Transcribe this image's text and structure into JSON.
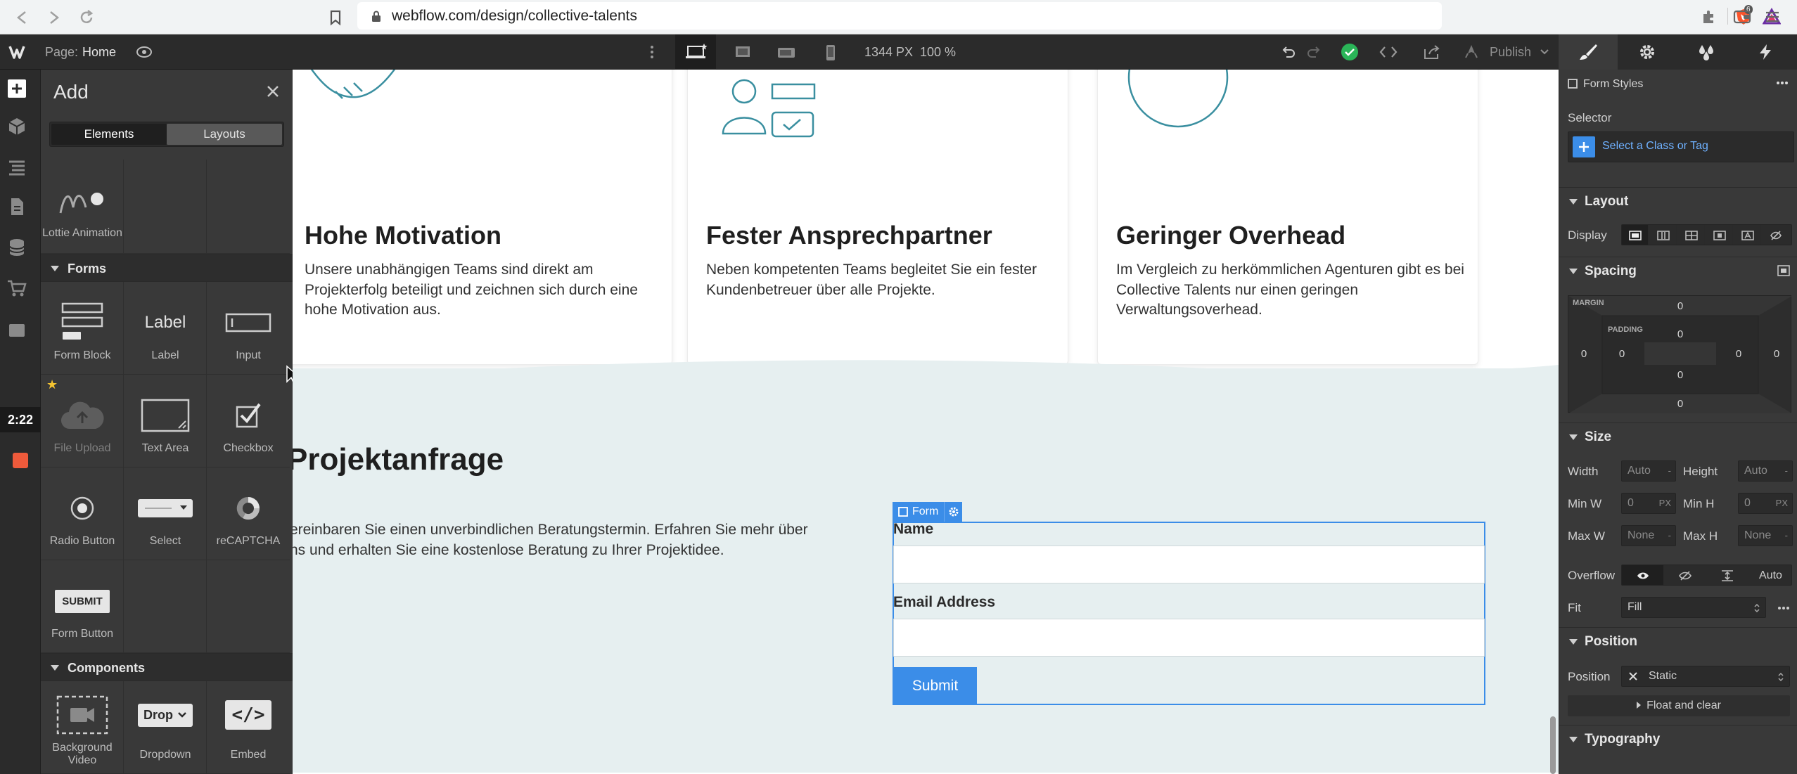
{
  "browser": {
    "url": "webflow.com/design/collective-talents",
    "badge_count": "6"
  },
  "topbar": {
    "page_label": "Page:",
    "page_name": "Home",
    "width_readout": "1344 PX",
    "zoom_readout": "100 %",
    "publish_label": "Publish"
  },
  "left_rail": {
    "timer": "2:22"
  },
  "add_panel": {
    "title": "Add",
    "tabs": [
      "Elements",
      "Layouts"
    ],
    "lottie_label": "Lottie Animation",
    "forms_header": "Forms",
    "form_items": [
      "Form Block",
      "Label",
      "Input",
      "File Upload",
      "Text Area",
      "Checkbox",
      "Radio Button",
      "Select",
      "reCAPTCHA",
      "Form Button"
    ],
    "label_tile_text": "Label",
    "submit_tile_text": "SUBMIT",
    "components_header": "Components",
    "component_items": [
      "Background Video",
      "Dropdown",
      "Embed"
    ],
    "dropdown_tile_text": "Drop",
    "embed_tile_text": "</>"
  },
  "canvas": {
    "cards": [
      {
        "title": "Hohe Motivation",
        "text": "Unsere unabhängigen Teams sind direkt am Projekterfolg beteiligt und zeichnen sich durch eine hohe Motivation aus."
      },
      {
        "title": "Fester Ansprechpartner",
        "text": "Neben kompetenten Teams begleitet Sie ein fester Kundenbetreuer über alle Projekte."
      },
      {
        "title": "Geringer Overhead",
        "text": "Im Vergleich zu herkömmlichen Agenturen gibt es bei Collective Talents nur einen geringen Verwaltungsoverhead."
      }
    ],
    "section_title": "Projektanfrage",
    "section_text_line1": "ereinbaren Sie einen unverbindlichen Beratungstermin. Erfahren Sie mehr über",
    "section_text_line2": "ns und erhalten Sie eine kostenlose Beratung zu Ihrer Projektidee.",
    "form_tag": "Form",
    "field_name_label": "Name",
    "field_email_label": "Email Address",
    "submit_label": "Submit"
  },
  "style_panel": {
    "element_name": "Form Styles",
    "selector_label": "Selector",
    "selector_placeholder": "Select a Class or Tag",
    "layout_header": "Layout",
    "display_label": "Display",
    "spacing_header": "Spacing",
    "margin_caption": "MARGIN",
    "padding_caption": "PADDING",
    "margin_values": {
      "top": "0",
      "right": "0",
      "bottom": "0",
      "left": "0"
    },
    "padding_values": {
      "top": "0",
      "right": "0",
      "bottom": "0",
      "left": "0"
    },
    "size_header": "Size",
    "width_label": "Width",
    "width_value": "Auto",
    "height_label": "Height",
    "height_value": "Auto",
    "minw_label": "Min W",
    "minw_value": "0",
    "minh_label": "Min H",
    "minh_value": "0",
    "maxw_label": "Max W",
    "maxw_value": "None",
    "maxh_label": "Max H",
    "maxh_value": "None",
    "unit_px": "PX",
    "unit_dash": "-",
    "overflow_label": "Overflow",
    "overflow_auto": "Auto",
    "fit_label": "Fit",
    "fit_value": "Fill",
    "position_header": "Position",
    "position_label": "Position",
    "position_value": "Static",
    "float_label": "Float and clear",
    "typography_header": "Typography"
  }
}
